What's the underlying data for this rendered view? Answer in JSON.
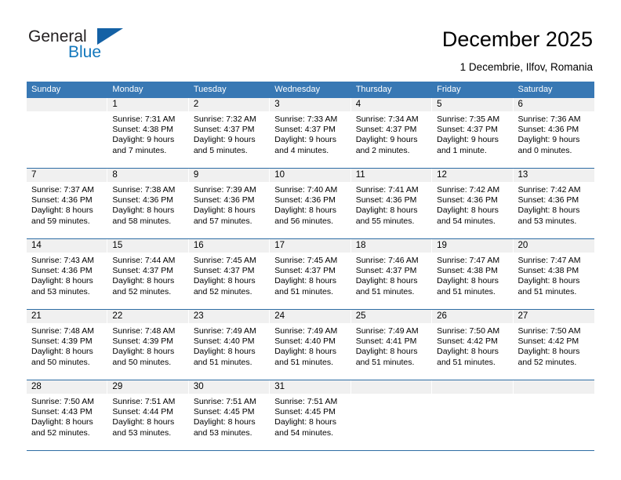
{
  "brand": {
    "name_part1": "General",
    "name_part2": "Blue",
    "accent_color": "#1277bc",
    "triangle_color": "#1461a5"
  },
  "header": {
    "title": "December 2025",
    "subtitle": "1 Decembrie, Ilfov, Romania"
  },
  "calendar": {
    "header_bg": "#3878b4",
    "daynum_bg": "#f0f0f0",
    "rule_color": "#2e6da4",
    "weekdays": [
      "Sunday",
      "Monday",
      "Tuesday",
      "Wednesday",
      "Thursday",
      "Friday",
      "Saturday"
    ],
    "weeks": [
      [
        {
          "day": "",
          "empty": true
        },
        {
          "day": "1",
          "sunrise": "Sunrise: 7:31 AM",
          "sunset": "Sunset: 4:38 PM",
          "daylight": "Daylight: 9 hours and 7 minutes."
        },
        {
          "day": "2",
          "sunrise": "Sunrise: 7:32 AM",
          "sunset": "Sunset: 4:37 PM",
          "daylight": "Daylight: 9 hours and 5 minutes."
        },
        {
          "day": "3",
          "sunrise": "Sunrise: 7:33 AM",
          "sunset": "Sunset: 4:37 PM",
          "daylight": "Daylight: 9 hours and 4 minutes."
        },
        {
          "day": "4",
          "sunrise": "Sunrise: 7:34 AM",
          "sunset": "Sunset: 4:37 PM",
          "daylight": "Daylight: 9 hours and 2 minutes."
        },
        {
          "day": "5",
          "sunrise": "Sunrise: 7:35 AM",
          "sunset": "Sunset: 4:37 PM",
          "daylight": "Daylight: 9 hours and 1 minute."
        },
        {
          "day": "6",
          "sunrise": "Sunrise: 7:36 AM",
          "sunset": "Sunset: 4:36 PM",
          "daylight": "Daylight: 9 hours and 0 minutes."
        }
      ],
      [
        {
          "day": "7",
          "sunrise": "Sunrise: 7:37 AM",
          "sunset": "Sunset: 4:36 PM",
          "daylight": "Daylight: 8 hours and 59 minutes."
        },
        {
          "day": "8",
          "sunrise": "Sunrise: 7:38 AM",
          "sunset": "Sunset: 4:36 PM",
          "daylight": "Daylight: 8 hours and 58 minutes."
        },
        {
          "day": "9",
          "sunrise": "Sunrise: 7:39 AM",
          "sunset": "Sunset: 4:36 PM",
          "daylight": "Daylight: 8 hours and 57 minutes."
        },
        {
          "day": "10",
          "sunrise": "Sunrise: 7:40 AM",
          "sunset": "Sunset: 4:36 PM",
          "daylight": "Daylight: 8 hours and 56 minutes."
        },
        {
          "day": "11",
          "sunrise": "Sunrise: 7:41 AM",
          "sunset": "Sunset: 4:36 PM",
          "daylight": "Daylight: 8 hours and 55 minutes."
        },
        {
          "day": "12",
          "sunrise": "Sunrise: 7:42 AM",
          "sunset": "Sunset: 4:36 PM",
          "daylight": "Daylight: 8 hours and 54 minutes."
        },
        {
          "day": "13",
          "sunrise": "Sunrise: 7:42 AM",
          "sunset": "Sunset: 4:36 PM",
          "daylight": "Daylight: 8 hours and 53 minutes."
        }
      ],
      [
        {
          "day": "14",
          "sunrise": "Sunrise: 7:43 AM",
          "sunset": "Sunset: 4:36 PM",
          "daylight": "Daylight: 8 hours and 53 minutes."
        },
        {
          "day": "15",
          "sunrise": "Sunrise: 7:44 AM",
          "sunset": "Sunset: 4:37 PM",
          "daylight": "Daylight: 8 hours and 52 minutes."
        },
        {
          "day": "16",
          "sunrise": "Sunrise: 7:45 AM",
          "sunset": "Sunset: 4:37 PM",
          "daylight": "Daylight: 8 hours and 52 minutes."
        },
        {
          "day": "17",
          "sunrise": "Sunrise: 7:45 AM",
          "sunset": "Sunset: 4:37 PM",
          "daylight": "Daylight: 8 hours and 51 minutes."
        },
        {
          "day": "18",
          "sunrise": "Sunrise: 7:46 AM",
          "sunset": "Sunset: 4:37 PM",
          "daylight": "Daylight: 8 hours and 51 minutes."
        },
        {
          "day": "19",
          "sunrise": "Sunrise: 7:47 AM",
          "sunset": "Sunset: 4:38 PM",
          "daylight": "Daylight: 8 hours and 51 minutes."
        },
        {
          "day": "20",
          "sunrise": "Sunrise: 7:47 AM",
          "sunset": "Sunset: 4:38 PM",
          "daylight": "Daylight: 8 hours and 51 minutes."
        }
      ],
      [
        {
          "day": "21",
          "sunrise": "Sunrise: 7:48 AM",
          "sunset": "Sunset: 4:39 PM",
          "daylight": "Daylight: 8 hours and 50 minutes."
        },
        {
          "day": "22",
          "sunrise": "Sunrise: 7:48 AM",
          "sunset": "Sunset: 4:39 PM",
          "daylight": "Daylight: 8 hours and 50 minutes."
        },
        {
          "day": "23",
          "sunrise": "Sunrise: 7:49 AM",
          "sunset": "Sunset: 4:40 PM",
          "daylight": "Daylight: 8 hours and 51 minutes."
        },
        {
          "day": "24",
          "sunrise": "Sunrise: 7:49 AM",
          "sunset": "Sunset: 4:40 PM",
          "daylight": "Daylight: 8 hours and 51 minutes."
        },
        {
          "day": "25",
          "sunrise": "Sunrise: 7:49 AM",
          "sunset": "Sunset: 4:41 PM",
          "daylight": "Daylight: 8 hours and 51 minutes."
        },
        {
          "day": "26",
          "sunrise": "Sunrise: 7:50 AM",
          "sunset": "Sunset: 4:42 PM",
          "daylight": "Daylight: 8 hours and 51 minutes."
        },
        {
          "day": "27",
          "sunrise": "Sunrise: 7:50 AM",
          "sunset": "Sunset: 4:42 PM",
          "daylight": "Daylight: 8 hours and 52 minutes."
        }
      ],
      [
        {
          "day": "28",
          "sunrise": "Sunrise: 7:50 AM",
          "sunset": "Sunset: 4:43 PM",
          "daylight": "Daylight: 8 hours and 52 minutes."
        },
        {
          "day": "29",
          "sunrise": "Sunrise: 7:51 AM",
          "sunset": "Sunset: 4:44 PM",
          "daylight": "Daylight: 8 hours and 53 minutes."
        },
        {
          "day": "30",
          "sunrise": "Sunrise: 7:51 AM",
          "sunset": "Sunset: 4:45 PM",
          "daylight": "Daylight: 8 hours and 53 minutes."
        },
        {
          "day": "31",
          "sunrise": "Sunrise: 7:51 AM",
          "sunset": "Sunset: 4:45 PM",
          "daylight": "Daylight: 8 hours and 54 minutes."
        },
        {
          "day": "",
          "empty": true
        },
        {
          "day": "",
          "empty": true
        },
        {
          "day": "",
          "empty": true
        }
      ]
    ]
  }
}
